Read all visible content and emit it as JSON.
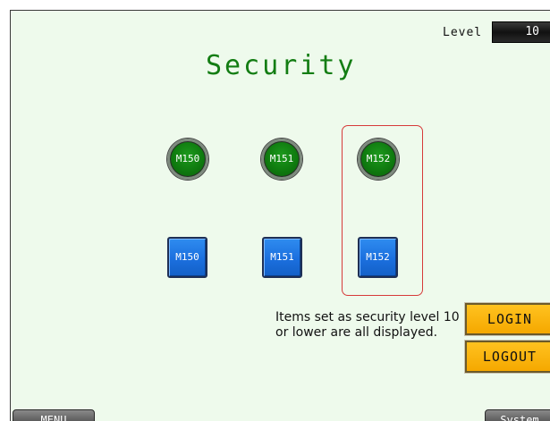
{
  "level": {
    "label": "Level",
    "value": "10"
  },
  "title": "Security",
  "lamps": [
    {
      "label": "M150",
      "color": "#0f7a0f"
    },
    {
      "label": "M151",
      "color": "#0f7a0f"
    },
    {
      "label": "M152",
      "color": "#0f7a0f"
    }
  ],
  "switches": [
    {
      "label": "M150",
      "color": "#1b6fde"
    },
    {
      "label": "M151",
      "color": "#1b6fde"
    },
    {
      "label": "M152",
      "color": "#1b6fde"
    }
  ],
  "note": "Items set as security level 10 or lower are all displayed.",
  "buttons": {
    "login": "LOGIN",
    "logout": "LOGOUT",
    "menu": "MENU",
    "system": "System"
  },
  "colors": {
    "background": "#eefaec",
    "title": "#137d13",
    "highlight": "#d63a3a",
    "gold_button": "#f5a800"
  }
}
